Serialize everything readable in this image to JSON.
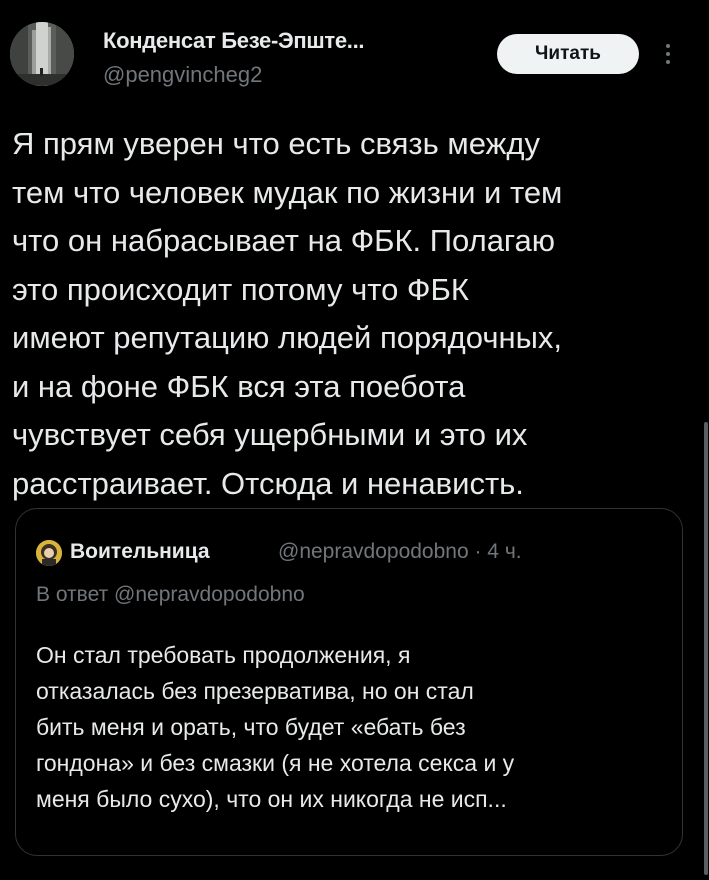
{
  "author": {
    "name": "Конденсат Безе-Эпште...",
    "handle": "@pengvincheg2"
  },
  "actions": {
    "follow_label": "Читать"
  },
  "tweet": {
    "lines": [
      "Я прям уверен что есть связь между",
      "тем что человек мудак по жизни и тем",
      "что он набрасывает на ФБК. Полагаю",
      "это происходит потому что ФБК",
      "имеют репутацию людей порядочных,",
      "и на фоне ФБК вся эта поебота",
      "чувствует себя ущербными и это их",
      "расстраивает. Отсюда и ненависть."
    ]
  },
  "quote": {
    "name": "Воительница",
    "handle_time": "@nepravdopodobno · 4 ч.",
    "reply_to": "В ответ @nepravdopodobno",
    "lines": [
      "Он  стал  требовать продолжения, я",
      "отказалась без презерватива, но он стал",
      "бить меня и орать, что будет «ебать без",
      "гондона» и без смазки (я не хотела секса и у",
      "меня было сухо), что он их никогда не исп..."
    ]
  },
  "colors": {
    "background": "#000000",
    "text_primary": "#e7e9ea",
    "text_secondary": "#71767b",
    "button_bg": "#eff3f4",
    "border": "#2f3336"
  },
  "icons": {
    "more": "more-vertical-icon"
  }
}
